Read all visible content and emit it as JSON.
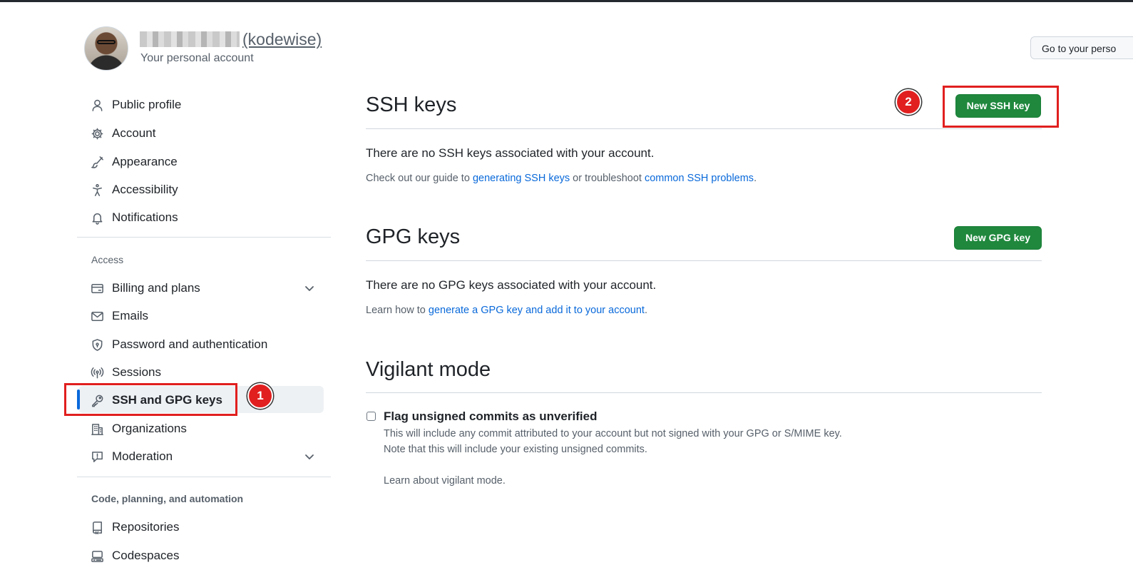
{
  "header": {
    "handle": "(kodewise)",
    "subtitle": "Your personal account",
    "goto_button": "Go to your perso"
  },
  "sidebar": {
    "items_top": [
      {
        "label": "Public profile",
        "icon": "person-icon"
      },
      {
        "label": "Account",
        "icon": "gear-icon"
      },
      {
        "label": "Appearance",
        "icon": "paintbrush-icon"
      },
      {
        "label": "Accessibility",
        "icon": "accessibility-icon"
      },
      {
        "label": "Notifications",
        "icon": "bell-icon"
      }
    ],
    "access_label": "Access",
    "items_access": [
      {
        "label": "Billing and plans",
        "icon": "credit-card-icon"
      },
      {
        "label": "Emails",
        "icon": "mail-icon"
      },
      {
        "label": "Password and authentication",
        "icon": "shield-lock-icon"
      },
      {
        "label": "Sessions",
        "icon": "broadcast-icon"
      },
      {
        "label": "SSH and GPG keys",
        "icon": "key-icon",
        "active": true
      },
      {
        "label": "Organizations",
        "icon": "organization-icon"
      },
      {
        "label": "Moderation",
        "icon": "report-icon"
      }
    ],
    "code_label": "Code, planning, and automation",
    "items_code": [
      {
        "label": "Repositories",
        "icon": "repo-icon"
      },
      {
        "label": "Codespaces",
        "icon": "codespaces-icon"
      }
    ]
  },
  "annotations": {
    "badge_1": "1",
    "badge_2": "2",
    "highlight_color": "#e11f1f"
  },
  "ssh": {
    "title": "SSH keys",
    "button": "New SSH key",
    "empty": "There are no SSH keys associated with your account.",
    "guide_prefix": "Check out our guide to ",
    "guide_link": "generating SSH keys",
    "guide_mid": " or troubleshoot ",
    "guide_link2": "common SSH problems",
    "guide_suffix": "."
  },
  "gpg": {
    "title": "GPG keys",
    "button": "New GPG key",
    "empty": "There are no GPG keys associated with your account.",
    "learn_prefix": "Learn how to ",
    "learn_link": "generate a GPG key and add it to your account",
    "learn_suffix": "."
  },
  "vigilant": {
    "title": "Vigilant mode",
    "checkbox_label": "Flag unsigned commits as unverified",
    "checked": false,
    "desc_line1": "This will include any commit attributed to your account but not signed with your GPG or S/MIME key.",
    "desc_line2": "Note that this will include your existing unsigned commits.",
    "learn_link": "Learn about vigilant mode."
  },
  "colors": {
    "accent_blue": "#0969da",
    "primary_green": "#1f883d"
  }
}
